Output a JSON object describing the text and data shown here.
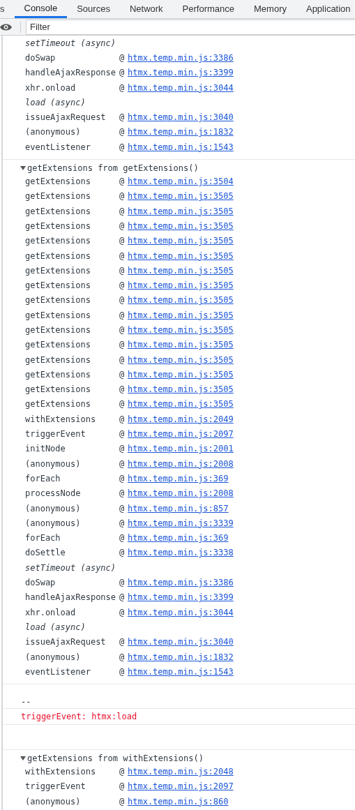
{
  "tabs": [
    {
      "label": "s",
      "selected": false
    },
    {
      "label": "Console",
      "selected": true
    },
    {
      "label": "Sources",
      "selected": false
    },
    {
      "label": "Network",
      "selected": false
    },
    {
      "label": "Performance",
      "selected": false
    },
    {
      "label": "Memory",
      "selected": false
    },
    {
      "label": "Application",
      "selected": false
    }
  ],
  "filter": {
    "placeholder": "Filter"
  },
  "messages": [
    {
      "kind": "trace",
      "frames": [
        {
          "kind": "async",
          "label": "setTimeout (async)"
        },
        {
          "kind": "frame",
          "name": "doSwap",
          "at": "@",
          "location": "htmx.temp.min.js:3386"
        },
        {
          "kind": "frame",
          "name": "handleAjaxResponse",
          "at": "@",
          "location": "htmx.temp.min.js:3399"
        },
        {
          "kind": "frame",
          "name": "xhr.onload",
          "at": "@",
          "location": "htmx.temp.min.js:3044"
        },
        {
          "kind": "async",
          "label": "load (async)"
        },
        {
          "kind": "frame",
          "name": "issueAjaxRequest",
          "at": "@",
          "location": "htmx.temp.min.js:3040"
        },
        {
          "kind": "frame",
          "name": "(anonymous)",
          "at": "@",
          "location": "htmx.temp.min.js:1832"
        },
        {
          "kind": "frame",
          "name": "eventListener",
          "at": "@",
          "location": "htmx.temp.min.js:1543"
        }
      ]
    },
    {
      "kind": "trace",
      "header": "getExtensions from getExtensions()",
      "expanded": true,
      "frames": [
        {
          "kind": "frame",
          "name": "getExtensions",
          "at": "@",
          "location": "htmx.temp.min.js:3504"
        },
        {
          "kind": "frame",
          "name": "getExtensions",
          "at": "@",
          "location": "htmx.temp.min.js:3505"
        },
        {
          "kind": "frame",
          "name": "getExtensions",
          "at": "@",
          "location": "htmx.temp.min.js:3505"
        },
        {
          "kind": "frame",
          "name": "getExtensions",
          "at": "@",
          "location": "htmx.temp.min.js:3505"
        },
        {
          "kind": "frame",
          "name": "getExtensions",
          "at": "@",
          "location": "htmx.temp.min.js:3505"
        },
        {
          "kind": "frame",
          "name": "getExtensions",
          "at": "@",
          "location": "htmx.temp.min.js:3505"
        },
        {
          "kind": "frame",
          "name": "getExtensions",
          "at": "@",
          "location": "htmx.temp.min.js:3505"
        },
        {
          "kind": "frame",
          "name": "getExtensions",
          "at": "@",
          "location": "htmx.temp.min.js:3505"
        },
        {
          "kind": "frame",
          "name": "getExtensions",
          "at": "@",
          "location": "htmx.temp.min.js:3505"
        },
        {
          "kind": "frame",
          "name": "getExtensions",
          "at": "@",
          "location": "htmx.temp.min.js:3505"
        },
        {
          "kind": "frame",
          "name": "getExtensions",
          "at": "@",
          "location": "htmx.temp.min.js:3505"
        },
        {
          "kind": "frame",
          "name": "getExtensions",
          "at": "@",
          "location": "htmx.temp.min.js:3505"
        },
        {
          "kind": "frame",
          "name": "getExtensions",
          "at": "@",
          "location": "htmx.temp.min.js:3505"
        },
        {
          "kind": "frame",
          "name": "getExtensions",
          "at": "@",
          "location": "htmx.temp.min.js:3505"
        },
        {
          "kind": "frame",
          "name": "getExtensions",
          "at": "@",
          "location": "htmx.temp.min.js:3505"
        },
        {
          "kind": "frame",
          "name": "getExtensions",
          "at": "@",
          "location": "htmx.temp.min.js:3505"
        },
        {
          "kind": "frame",
          "name": "withExtensions",
          "at": "@",
          "location": "htmx.temp.min.js:2049"
        },
        {
          "kind": "frame",
          "name": "triggerEvent",
          "at": "@",
          "location": "htmx.temp.min.js:2097"
        },
        {
          "kind": "frame",
          "name": "initNode",
          "at": "@",
          "location": "htmx.temp.min.js:2001"
        },
        {
          "kind": "frame",
          "name": "(anonymous)",
          "at": "@",
          "location": "htmx.temp.min.js:2008"
        },
        {
          "kind": "frame",
          "name": "forEach",
          "at": "@",
          "location": "htmx.temp.min.js:369"
        },
        {
          "kind": "frame",
          "name": "processNode",
          "at": "@",
          "location": "htmx.temp.min.js:2008"
        },
        {
          "kind": "frame",
          "name": "(anonymous)",
          "at": "@",
          "location": "htmx.temp.min.js:857"
        },
        {
          "kind": "frame",
          "name": "(anonymous)",
          "at": "@",
          "location": "htmx.temp.min.js:3339"
        },
        {
          "kind": "frame",
          "name": "forEach",
          "at": "@",
          "location": "htmx.temp.min.js:369"
        },
        {
          "kind": "frame",
          "name": "doSettle",
          "at": "@",
          "location": "htmx.temp.min.js:3338"
        },
        {
          "kind": "async",
          "label": "setTimeout (async)"
        },
        {
          "kind": "frame",
          "name": "doSwap",
          "at": "@",
          "location": "htmx.temp.min.js:3386"
        },
        {
          "kind": "frame",
          "name": "handleAjaxResponse",
          "at": "@",
          "location": "htmx.temp.min.js:3399"
        },
        {
          "kind": "frame",
          "name": "xhr.onload",
          "at": "@",
          "location": "htmx.temp.min.js:3044"
        },
        {
          "kind": "async",
          "label": "load (async)"
        },
        {
          "kind": "frame",
          "name": "issueAjaxRequest",
          "at": "@",
          "location": "htmx.temp.min.js:3040"
        },
        {
          "kind": "frame",
          "name": "(anonymous)",
          "at": "@",
          "location": "htmx.temp.min.js:1832"
        },
        {
          "kind": "frame",
          "name": "eventListener",
          "at": "@",
          "location": "htmx.temp.min.js:1543"
        }
      ]
    },
    {
      "kind": "log",
      "text": "--"
    },
    {
      "kind": "error",
      "text": "triggerEvent: htmx:load"
    },
    {
      "kind": "empty"
    },
    {
      "kind": "trace",
      "header": "getExtensions from withExtensions()",
      "expanded": true,
      "frames": [
        {
          "kind": "frame",
          "name": "withExtensions",
          "at": "@",
          "location": "htmx.temp.min.js:2048"
        },
        {
          "kind": "frame",
          "name": "triggerEvent",
          "at": "@",
          "location": "htmx.temp.min.js:2097"
        },
        {
          "kind": "frame",
          "name": "(anonymous)",
          "at": "@",
          "location": "htmx.temp.min.js:860"
        }
      ]
    }
  ]
}
